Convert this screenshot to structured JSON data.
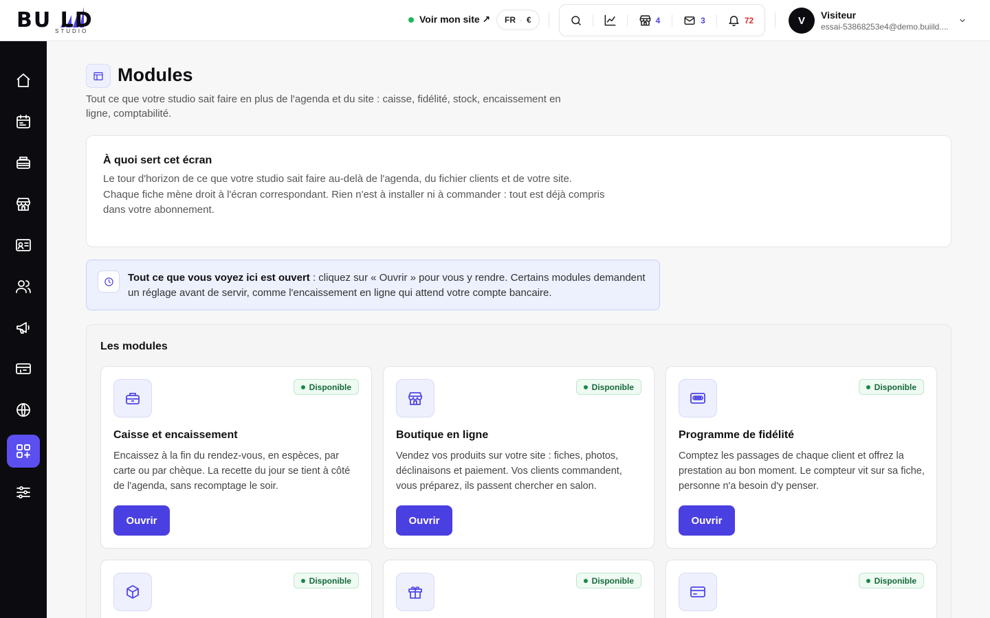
{
  "brand": {
    "name": "BU  LD",
    "sub": "STUDIO"
  },
  "header": {
    "site_link": "Voir mon site ↗",
    "lang": "FR",
    "currency": "€",
    "counts": {
      "stores": "4",
      "messages": "3",
      "notifications": "72"
    },
    "user": {
      "initial": "V",
      "name": "Visiteur",
      "email": "essai-53868253e4@demo.buiild...."
    }
  },
  "sidebar": {
    "items": [
      {
        "name": "home",
        "icon": "home-icon"
      },
      {
        "name": "agenda",
        "icon": "calendar-icon"
      },
      {
        "name": "caisse",
        "icon": "register-icon"
      },
      {
        "name": "boutique",
        "icon": "store-icon"
      },
      {
        "name": "fiches",
        "icon": "id-card-icon"
      },
      {
        "name": "clients",
        "icon": "users-icon"
      },
      {
        "name": "marketing",
        "icon": "megaphone-icon"
      },
      {
        "name": "paiement",
        "icon": "card-icon"
      },
      {
        "name": "site",
        "icon": "globe-icon"
      },
      {
        "name": "modules",
        "icon": "modules-icon",
        "active": true
      },
      {
        "name": "reglages",
        "icon": "sliders-icon"
      }
    ]
  },
  "page": {
    "title": "Modules",
    "subtitle": "Tout ce que votre studio sait faire en plus de l'agenda et du site : caisse, fidélité, stock, encaissement en ligne, comptabilité."
  },
  "info": {
    "title": "À quoi sert cet écran",
    "text": "Le tour d'horizon de ce que votre studio sait faire au-delà de l'agenda, du fichier clients et de votre site. Chaque fiche mène droit à l'écran correspondant. Rien n'est à installer ni à commander : tout est déjà compris dans votre abonnement."
  },
  "notice": {
    "bold": "Tout ce que vous voyez ici est ouvert",
    "text": " : cliquez sur « Ouvrir » pour vous y rendre. Certains modules demandent un réglage avant de servir, comme l'encaissement en ligne qui attend votre compte bancaire."
  },
  "modules": {
    "title": "Les modules",
    "items": [
      {
        "icon": "register-icon",
        "status": "Disponible",
        "title": "Caisse et encaissement",
        "desc": "Encaissez à la fin du rendez-vous, en espèces, par carte ou par chèque. La recette du jour se tient à côté de l'agenda, sans recomptage le soir.",
        "button": "Ouvrir"
      },
      {
        "icon": "store-icon",
        "status": "Disponible",
        "title": "Boutique en ligne",
        "desc": "Vendez vos produits sur votre site : fiches, photos, déclinaisons et paiement. Vos clients commandent, vous préparez, ils passent chercher en salon.",
        "button": "Ouvrir"
      },
      {
        "icon": "loyalty-card-icon",
        "status": "Disponible",
        "title": "Programme de fidélité",
        "desc": "Comptez les passages de chaque client et offrez la prestation au bon moment. Le compteur vit sur sa fiche, personne n'a besoin d'y penser.",
        "button": "Ouvrir"
      },
      {
        "icon": "box-icon",
        "status": "Disponible"
      },
      {
        "icon": "gift-icon",
        "status": "Disponible"
      },
      {
        "icon": "credit-card-icon",
        "status": "Disponible"
      }
    ]
  },
  "colors": {
    "accent": "#4a3fe0",
    "sidebar": "#0c0c10",
    "available": "#168a45"
  }
}
